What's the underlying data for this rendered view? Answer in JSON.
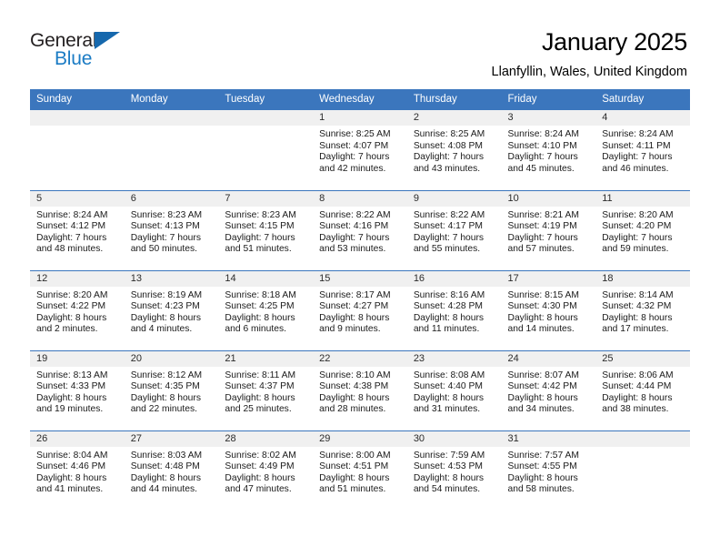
{
  "logo": {
    "word_one": "General",
    "word_two": "Blue",
    "triangle_icon": "triangle-icon",
    "dark_color": "#231f20",
    "blue_color": "#1a7bc4",
    "triangle_color": "#1668ad"
  },
  "header": {
    "title": "January 2025",
    "location": "Llanfyllin, Wales, United Kingdom"
  },
  "theme": {
    "header_band": "#3b76bd",
    "daynum_band": "#f0f0f0",
    "cell_background": "#ffffff",
    "text": "#000000"
  },
  "weekday_headers": [
    "Sunday",
    "Monday",
    "Tuesday",
    "Wednesday",
    "Thursday",
    "Friday",
    "Saturday"
  ],
  "weeks": [
    [
      {
        "day": "",
        "sunrise": "",
        "sunset": "",
        "daylight_line1": "",
        "daylight_line2": ""
      },
      {
        "day": "",
        "sunrise": "",
        "sunset": "",
        "daylight_line1": "",
        "daylight_line2": ""
      },
      {
        "day": "",
        "sunrise": "",
        "sunset": "",
        "daylight_line1": "",
        "daylight_line2": ""
      },
      {
        "day": "1",
        "sunrise": "Sunrise: 8:25 AM",
        "sunset": "Sunset: 4:07 PM",
        "daylight_line1": "Daylight: 7 hours",
        "daylight_line2": "and 42 minutes."
      },
      {
        "day": "2",
        "sunrise": "Sunrise: 8:25 AM",
        "sunset": "Sunset: 4:08 PM",
        "daylight_line1": "Daylight: 7 hours",
        "daylight_line2": "and 43 minutes."
      },
      {
        "day": "3",
        "sunrise": "Sunrise: 8:24 AM",
        "sunset": "Sunset: 4:10 PM",
        "daylight_line1": "Daylight: 7 hours",
        "daylight_line2": "and 45 minutes."
      },
      {
        "day": "4",
        "sunrise": "Sunrise: 8:24 AM",
        "sunset": "Sunset: 4:11 PM",
        "daylight_line1": "Daylight: 7 hours",
        "daylight_line2": "and 46 minutes."
      }
    ],
    [
      {
        "day": "5",
        "sunrise": "Sunrise: 8:24 AM",
        "sunset": "Sunset: 4:12 PM",
        "daylight_line1": "Daylight: 7 hours",
        "daylight_line2": "and 48 minutes."
      },
      {
        "day": "6",
        "sunrise": "Sunrise: 8:23 AM",
        "sunset": "Sunset: 4:13 PM",
        "daylight_line1": "Daylight: 7 hours",
        "daylight_line2": "and 50 minutes."
      },
      {
        "day": "7",
        "sunrise": "Sunrise: 8:23 AM",
        "sunset": "Sunset: 4:15 PM",
        "daylight_line1": "Daylight: 7 hours",
        "daylight_line2": "and 51 minutes."
      },
      {
        "day": "8",
        "sunrise": "Sunrise: 8:22 AM",
        "sunset": "Sunset: 4:16 PM",
        "daylight_line1": "Daylight: 7 hours",
        "daylight_line2": "and 53 minutes."
      },
      {
        "day": "9",
        "sunrise": "Sunrise: 8:22 AM",
        "sunset": "Sunset: 4:17 PM",
        "daylight_line1": "Daylight: 7 hours",
        "daylight_line2": "and 55 minutes."
      },
      {
        "day": "10",
        "sunrise": "Sunrise: 8:21 AM",
        "sunset": "Sunset: 4:19 PM",
        "daylight_line1": "Daylight: 7 hours",
        "daylight_line2": "and 57 minutes."
      },
      {
        "day": "11",
        "sunrise": "Sunrise: 8:20 AM",
        "sunset": "Sunset: 4:20 PM",
        "daylight_line1": "Daylight: 7 hours",
        "daylight_line2": "and 59 minutes."
      }
    ],
    [
      {
        "day": "12",
        "sunrise": "Sunrise: 8:20 AM",
        "sunset": "Sunset: 4:22 PM",
        "daylight_line1": "Daylight: 8 hours",
        "daylight_line2": "and 2 minutes."
      },
      {
        "day": "13",
        "sunrise": "Sunrise: 8:19 AM",
        "sunset": "Sunset: 4:23 PM",
        "daylight_line1": "Daylight: 8 hours",
        "daylight_line2": "and 4 minutes."
      },
      {
        "day": "14",
        "sunrise": "Sunrise: 8:18 AM",
        "sunset": "Sunset: 4:25 PM",
        "daylight_line1": "Daylight: 8 hours",
        "daylight_line2": "and 6 minutes."
      },
      {
        "day": "15",
        "sunrise": "Sunrise: 8:17 AM",
        "sunset": "Sunset: 4:27 PM",
        "daylight_line1": "Daylight: 8 hours",
        "daylight_line2": "and 9 minutes."
      },
      {
        "day": "16",
        "sunrise": "Sunrise: 8:16 AM",
        "sunset": "Sunset: 4:28 PM",
        "daylight_line1": "Daylight: 8 hours",
        "daylight_line2": "and 11 minutes."
      },
      {
        "day": "17",
        "sunrise": "Sunrise: 8:15 AM",
        "sunset": "Sunset: 4:30 PM",
        "daylight_line1": "Daylight: 8 hours",
        "daylight_line2": "and 14 minutes."
      },
      {
        "day": "18",
        "sunrise": "Sunrise: 8:14 AM",
        "sunset": "Sunset: 4:32 PM",
        "daylight_line1": "Daylight: 8 hours",
        "daylight_line2": "and 17 minutes."
      }
    ],
    [
      {
        "day": "19",
        "sunrise": "Sunrise: 8:13 AM",
        "sunset": "Sunset: 4:33 PM",
        "daylight_line1": "Daylight: 8 hours",
        "daylight_line2": "and 19 minutes."
      },
      {
        "day": "20",
        "sunrise": "Sunrise: 8:12 AM",
        "sunset": "Sunset: 4:35 PM",
        "daylight_line1": "Daylight: 8 hours",
        "daylight_line2": "and 22 minutes."
      },
      {
        "day": "21",
        "sunrise": "Sunrise: 8:11 AM",
        "sunset": "Sunset: 4:37 PM",
        "daylight_line1": "Daylight: 8 hours",
        "daylight_line2": "and 25 minutes."
      },
      {
        "day": "22",
        "sunrise": "Sunrise: 8:10 AM",
        "sunset": "Sunset: 4:38 PM",
        "daylight_line1": "Daylight: 8 hours",
        "daylight_line2": "and 28 minutes."
      },
      {
        "day": "23",
        "sunrise": "Sunrise: 8:08 AM",
        "sunset": "Sunset: 4:40 PM",
        "daylight_line1": "Daylight: 8 hours",
        "daylight_line2": "and 31 minutes."
      },
      {
        "day": "24",
        "sunrise": "Sunrise: 8:07 AM",
        "sunset": "Sunset: 4:42 PM",
        "daylight_line1": "Daylight: 8 hours",
        "daylight_line2": "and 34 minutes."
      },
      {
        "day": "25",
        "sunrise": "Sunrise: 8:06 AM",
        "sunset": "Sunset: 4:44 PM",
        "daylight_line1": "Daylight: 8 hours",
        "daylight_line2": "and 38 minutes."
      }
    ],
    [
      {
        "day": "26",
        "sunrise": "Sunrise: 8:04 AM",
        "sunset": "Sunset: 4:46 PM",
        "daylight_line1": "Daylight: 8 hours",
        "daylight_line2": "and 41 minutes."
      },
      {
        "day": "27",
        "sunrise": "Sunrise: 8:03 AM",
        "sunset": "Sunset: 4:48 PM",
        "daylight_line1": "Daylight: 8 hours",
        "daylight_line2": "and 44 minutes."
      },
      {
        "day": "28",
        "sunrise": "Sunrise: 8:02 AM",
        "sunset": "Sunset: 4:49 PM",
        "daylight_line1": "Daylight: 8 hours",
        "daylight_line2": "and 47 minutes."
      },
      {
        "day": "29",
        "sunrise": "Sunrise: 8:00 AM",
        "sunset": "Sunset: 4:51 PM",
        "daylight_line1": "Daylight: 8 hours",
        "daylight_line2": "and 51 minutes."
      },
      {
        "day": "30",
        "sunrise": "Sunrise: 7:59 AM",
        "sunset": "Sunset: 4:53 PM",
        "daylight_line1": "Daylight: 8 hours",
        "daylight_line2": "and 54 minutes."
      },
      {
        "day": "31",
        "sunrise": "Sunrise: 7:57 AM",
        "sunset": "Sunset: 4:55 PM",
        "daylight_line1": "Daylight: 8 hours",
        "daylight_line2": "and 58 minutes."
      },
      {
        "day": "",
        "sunrise": "",
        "sunset": "",
        "daylight_line1": "",
        "daylight_line2": ""
      }
    ]
  ]
}
